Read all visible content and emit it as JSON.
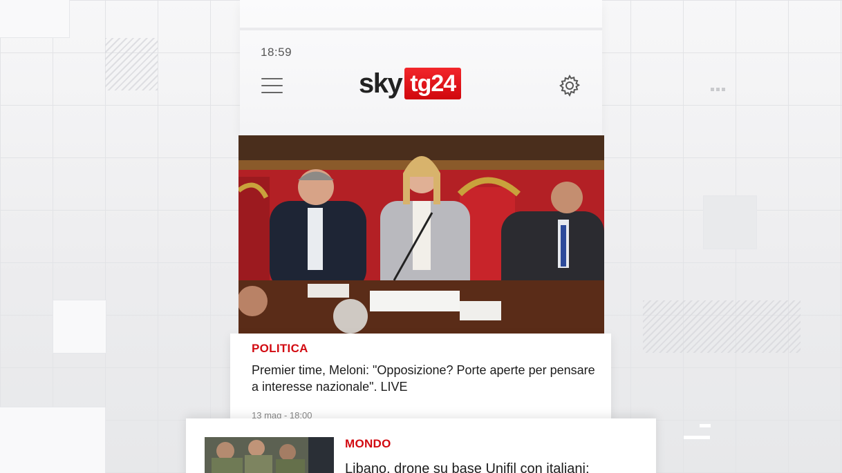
{
  "status_bar": {
    "time": "18:59"
  },
  "header": {
    "menu_icon": "hamburger-menu-icon",
    "logo": {
      "sky": "sky",
      "tg24": "tg24"
    },
    "settings_icon": "gear-icon"
  },
  "colors": {
    "brand_red": "#e0141a",
    "text_dark": "#1c1c1c",
    "meta_gray": "#888888"
  },
  "feed": [
    {
      "category": "POLITICA",
      "headline": "Premier time, Meloni: \"Opposizione? Porte aperte per pensare a interesse nazionale\". LIVE",
      "date": "13 mag - 18:00"
    },
    {
      "category": "MONDO",
      "headline": "Libano, drone su base Unifil con italiani:"
    }
  ]
}
